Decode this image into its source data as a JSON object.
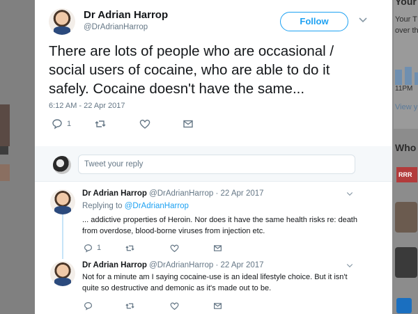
{
  "background": {
    "right_texts": [
      "Your",
      "Your T",
      "over th",
      "11PM",
      "View y",
      "Who"
    ],
    "right_bars": [
      1,
      2,
      3
    ],
    "right_avatar_badge": "RRR"
  },
  "tweet": {
    "author_name": "Dr Adrian Harrop",
    "author_handle": "@DrAdrianHarrop",
    "follow_label": "Follow",
    "text": "There are lots of people who are occasional / social users of cocaine, who are able to do it safely. Cocaine doesn't have the same...",
    "timestamp": "6:12 AM - 22 Apr 2017",
    "reply_count": "1",
    "colors": {
      "accent": "#1da1f2",
      "muted": "#657786",
      "text": "#14171a"
    }
  },
  "reply_box": {
    "placeholder": "Tweet your reply"
  },
  "replies": [
    {
      "name": "Dr Adrian Harrop",
      "meta": "@DrAdrianHarrop · 22 Apr 2017",
      "replying_to_label": "Replying to",
      "replying_to_handle": "@DrAdrianHarrop",
      "text": "... addictive properties of Heroin. Nor does it have the same health risks re: death from overdose, blood-borne viruses from injection etc.",
      "reply_count": "1"
    },
    {
      "name": "Dr Adrian Harrop",
      "meta": "@DrAdrianHarrop · 22 Apr 2017",
      "text": "Not for a minute am I saying cocaine-use is an ideal lifestyle choice. But it isn't quite so destructive and demonic as it's made out to be.",
      "reply_count": ""
    }
  ]
}
